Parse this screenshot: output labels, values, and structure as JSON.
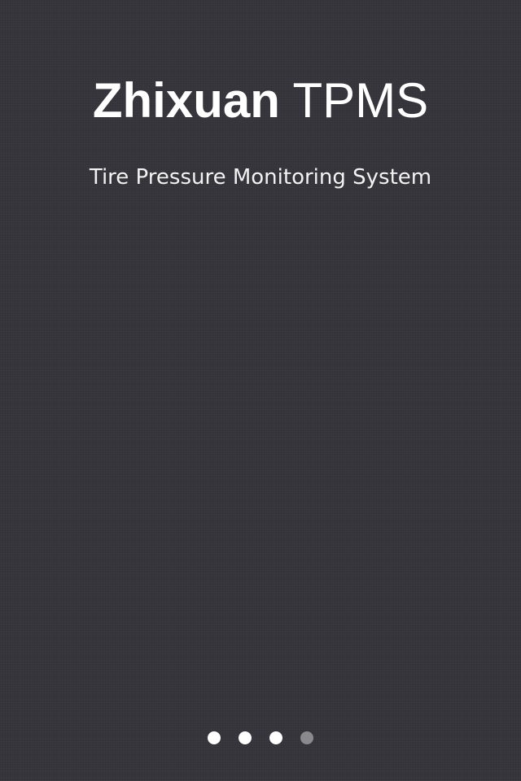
{
  "splash": {
    "title_brand": "Zhixuan",
    "title_product": "TPMS",
    "subtitle": "Tire Pressure Monitoring System"
  },
  "pager": {
    "total_pages": 4,
    "current_page": 4,
    "active_color": "#ffffff",
    "inactive_color": "#8a898e"
  },
  "colors": {
    "background": "#36353b",
    "text": "#ffffff"
  }
}
